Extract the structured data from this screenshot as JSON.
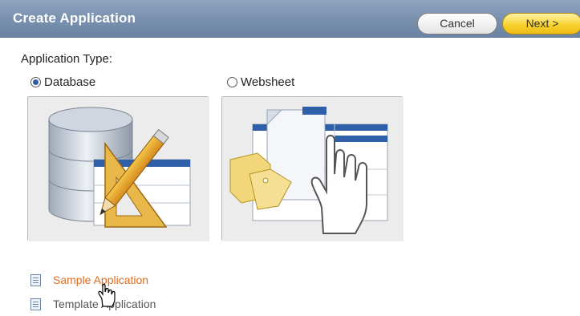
{
  "header": {
    "title": "Create Application",
    "cancel_label": "Cancel",
    "next_label": "Next >"
  },
  "main": {
    "app_type_label": "Application Type:",
    "options": [
      {
        "label": "Database",
        "selected": true,
        "icon": "database-design-icon"
      },
      {
        "label": "Websheet",
        "selected": false,
        "icon": "websheet-hand-icon"
      }
    ],
    "links": [
      {
        "label": "Sample Application",
        "icon": "document-icon"
      },
      {
        "label": "Template Application",
        "icon": "document-icon"
      }
    ]
  },
  "colors": {
    "title_bar": "#7890ad",
    "next_button": "#f8cf2a",
    "link_active": "#e06b1f"
  }
}
